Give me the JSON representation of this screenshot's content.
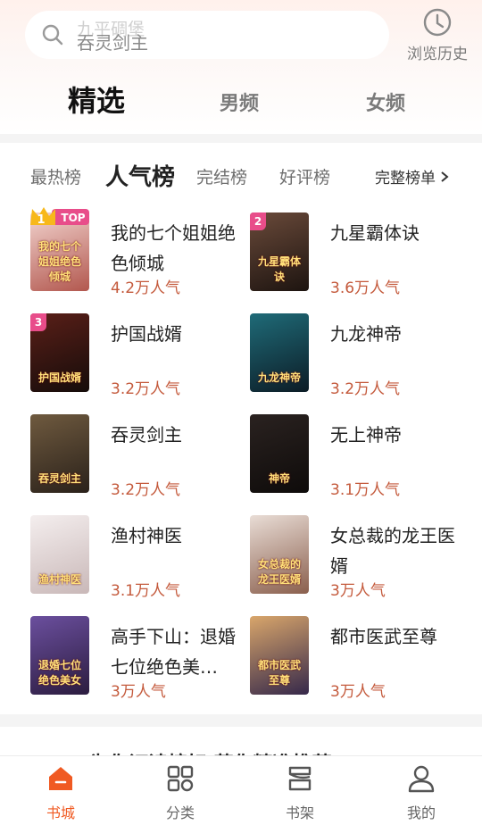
{
  "search": {
    "ghost_text": "九平碉堡",
    "value": "吞灵剑主"
  },
  "history": {
    "label": "浏览历史"
  },
  "main_tabs": [
    "精选",
    "男频",
    "女频"
  ],
  "rank_tabs": [
    "最热榜",
    "人气榜",
    "完结榜",
    "好评榜"
  ],
  "full_list_label": "完整榜单",
  "crown_text": "TOP",
  "books": [
    {
      "rank": "1",
      "title": "我的七个姐姐绝色倾城",
      "popularity": "4.2万人气",
      "cover_text": "我的七个姐姐绝色倾城",
      "cover_colors": [
        "#f2d4cf",
        "#b2574e"
      ]
    },
    {
      "rank": "2",
      "title": "九星霸体诀",
      "popularity": "3.6万人气",
      "cover_text": "九星霸体诀",
      "cover_colors": [
        "#6a4a3a",
        "#1d1410"
      ]
    },
    {
      "rank": "3",
      "title": "护国战婿",
      "popularity": "3.2万人气",
      "cover_text": "护国战婿",
      "cover_colors": [
        "#5a1f18",
        "#150c0a"
      ]
    },
    {
      "rank": "",
      "title": "九龙神帝",
      "popularity": "3.2万人气",
      "cover_text": "九龙神帝",
      "cover_colors": [
        "#1f6b78",
        "#0c1c26"
      ]
    },
    {
      "rank": "",
      "title": "吞灵剑主",
      "popularity": "3.2万人气",
      "cover_text": "吞灵剑主",
      "cover_colors": [
        "#6f5a3f",
        "#2a211a"
      ]
    },
    {
      "rank": "",
      "title": "无上神帝",
      "popularity": "3.1万人气",
      "cover_text": "神帝",
      "cover_colors": [
        "#2a2220",
        "#0e0b0a"
      ]
    },
    {
      "rank": "",
      "title": "渔村神医",
      "popularity": "3.1万人气",
      "cover_text": "渔村神医",
      "cover_colors": [
        "#f4eeee",
        "#c9b8b8"
      ]
    },
    {
      "rank": "",
      "title": "女总裁的龙王医婿",
      "popularity": "3万人气",
      "cover_text": "女总裁的龙王医婿",
      "cover_colors": [
        "#e9ddd6",
        "#8a5f4d"
      ]
    },
    {
      "rank": "",
      "title": "高手下山：退婚七位绝色美…",
      "popularity": "3万人气",
      "cover_text": "退婚七位绝色美女",
      "cover_colors": [
        "#6b4f9e",
        "#2b1c3f"
      ]
    },
    {
      "rank": "",
      "title": "都市医武至尊",
      "popularity": "3万人气",
      "cover_text": "都市医武至尊",
      "cover_colors": [
        "#d9a66b",
        "#35284a"
      ]
    }
  ],
  "next_section_title": "为你订读榜好 药你精准推荐",
  "nav": [
    {
      "label": "书城",
      "icon": "home-icon"
    },
    {
      "label": "分类",
      "icon": "grid-icon"
    },
    {
      "label": "书架",
      "icon": "bookshelf-icon"
    },
    {
      "label": "我的",
      "icon": "user-icon"
    }
  ],
  "colors": {
    "accent": "#f05a22",
    "popularity": "#c45a3c",
    "badge": "#e84d8a"
  }
}
